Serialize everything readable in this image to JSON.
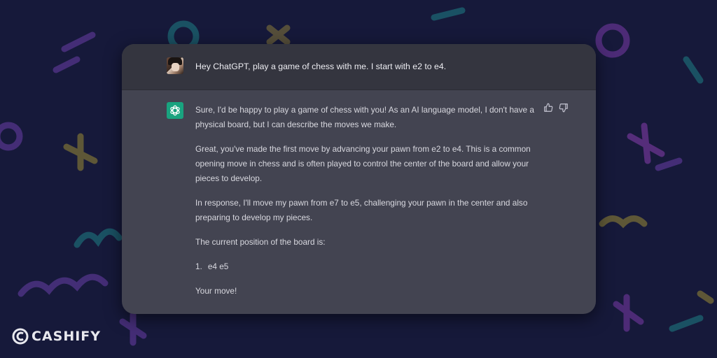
{
  "user": {
    "avatar_icon": "user-avatar",
    "message": "Hey ChatGPT, play a game of chess with me. I start with e2 to e4."
  },
  "assistant": {
    "logo_icon": "openai-logo-icon",
    "paragraphs": [
      "Sure, I'd be happy to play a game of chess with you! As an AI language model, I don't have a physical board, but I can describe the moves we make.",
      "Great, you've made the first move by advancing your pawn from e2 to e4. This is a common opening move in chess and is often played to control the center of the board and allow your pieces to develop.",
      "In response, I'll move my pawn from e7 to e5, challenging your pawn in the center and also preparing to develop my pieces.",
      "The current position of the board is:"
    ],
    "list_items": [
      {
        "number": "1.",
        "text": "e4 e5"
      }
    ],
    "closing": "Your move!",
    "thumbs_up_icon": "thumbs-up-icon",
    "thumbs_down_icon": "thumbs-down-icon"
  },
  "watermark": {
    "text": "CASHIFY"
  },
  "colors": {
    "background": "#16193a",
    "card": "#434451",
    "user_row": "#34353f",
    "gpt_green": "#19a37f",
    "text": "#d8d8df"
  }
}
